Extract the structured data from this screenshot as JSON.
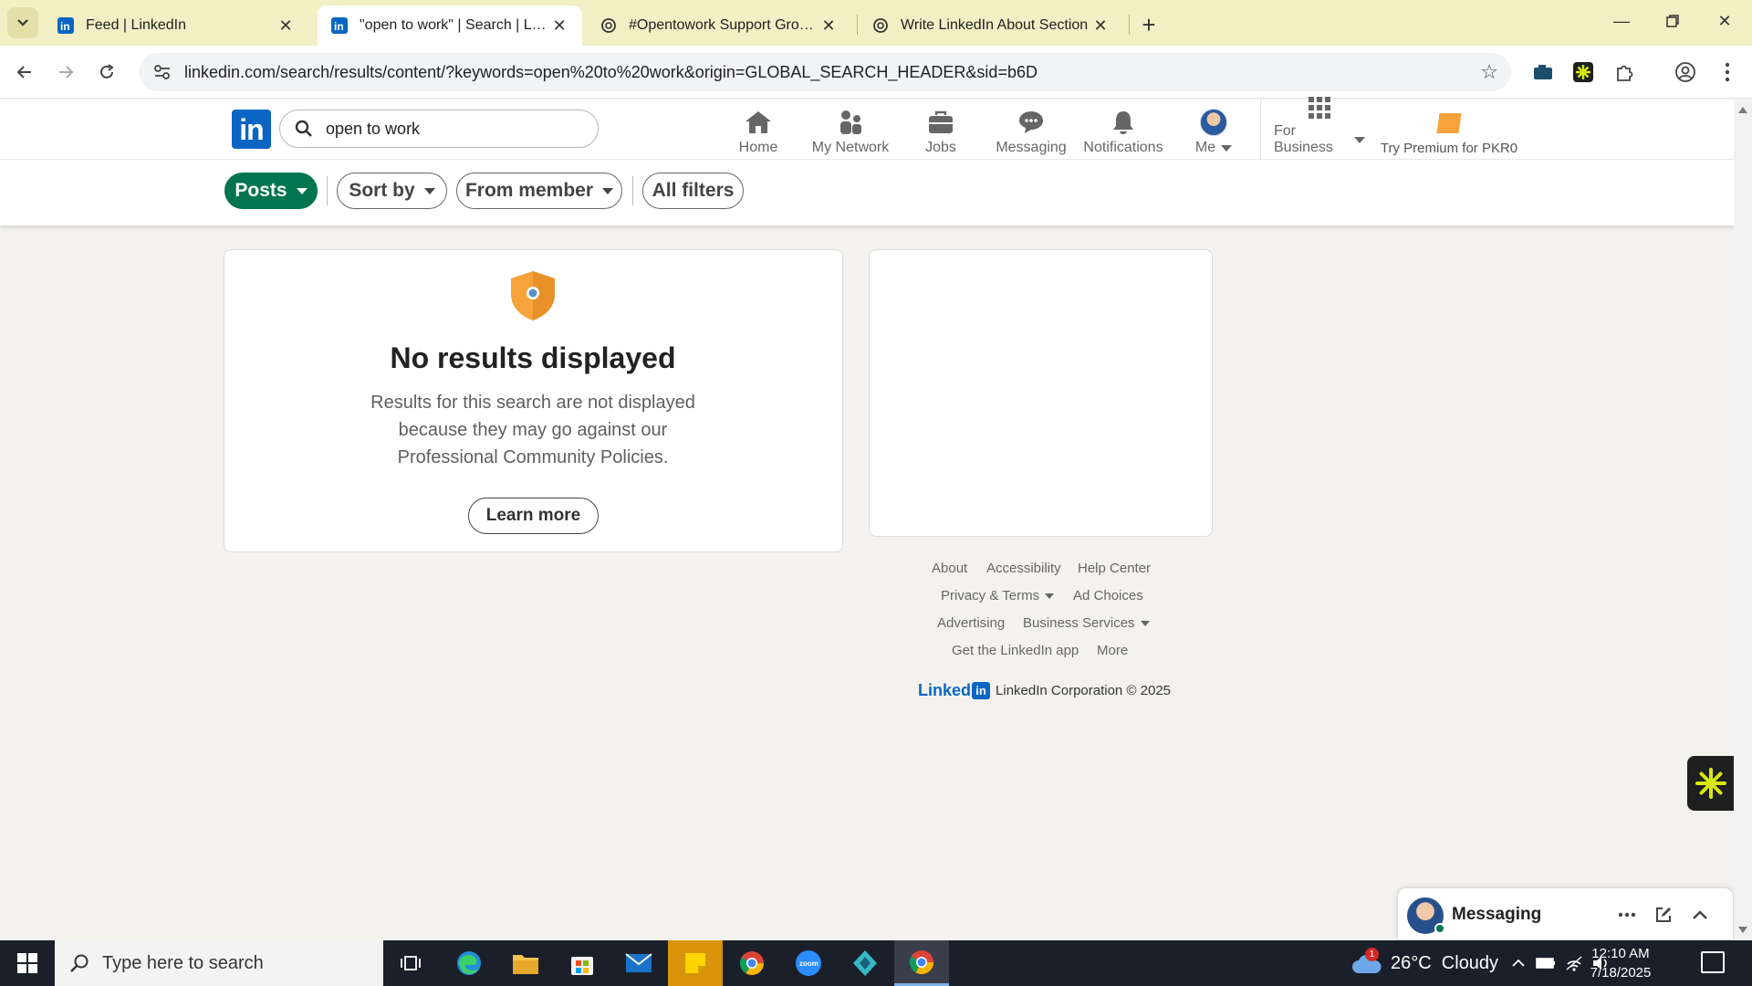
{
  "browser": {
    "tabs": [
      {
        "title": "Feed | LinkedIn",
        "active": false
      },
      {
        "title": "\"open to work\" | Search | LinkedIn",
        "active": true
      },
      {
        "title": "#Opentowork Support Group | LinkedIn",
        "active": false
      },
      {
        "title": "Write LinkedIn About Section",
        "active": false
      }
    ],
    "url": "linkedin.com/search/results/content/?keywords=open%20to%20work&origin=GLOBAL_SEARCH_HEADER&sid=b6D"
  },
  "linkedin": {
    "logo_text": "in",
    "search": {
      "value": "open to work"
    },
    "nav": {
      "home": "Home",
      "network": "My Network",
      "jobs": "Jobs",
      "messaging": "Messaging",
      "notifications": "Notifications",
      "me": "Me",
      "business": "For Business",
      "premium": "Try Premium for PKR0"
    },
    "filters": {
      "posts": "Posts",
      "sort_by": "Sort by",
      "from_member": "From member",
      "all_filters": "All filters"
    },
    "results": {
      "title": "No results displayed",
      "description": "Results for this search are not displayed because they may go against our Professional Community Policies.",
      "learn_more": "Learn more"
    },
    "footer": {
      "about": "About",
      "accessibility": "Accessibility",
      "help_center": "Help Center",
      "privacy_terms": "Privacy & Terms",
      "ad_choices": "Ad Choices",
      "advertising": "Advertising",
      "business_services": "Business Services",
      "get_app": "Get the LinkedIn app",
      "more": "More",
      "brand_word": "Linked",
      "brand_box": "in",
      "copyright": "LinkedIn Corporation © 2025"
    },
    "messaging_bar": {
      "label": "Messaging"
    }
  },
  "taskbar": {
    "search_placeholder": "Type here to search",
    "weather": "26°C  Cloudy",
    "weather_badge": "1",
    "time": "12:10 AM",
    "date": "7/18/2025"
  },
  "colors": {
    "linkedin_blue": "#0a66c2",
    "posts_green": "#01754f",
    "tab_strip": "#f3efc5",
    "shield_orange": "#f5a33a"
  }
}
